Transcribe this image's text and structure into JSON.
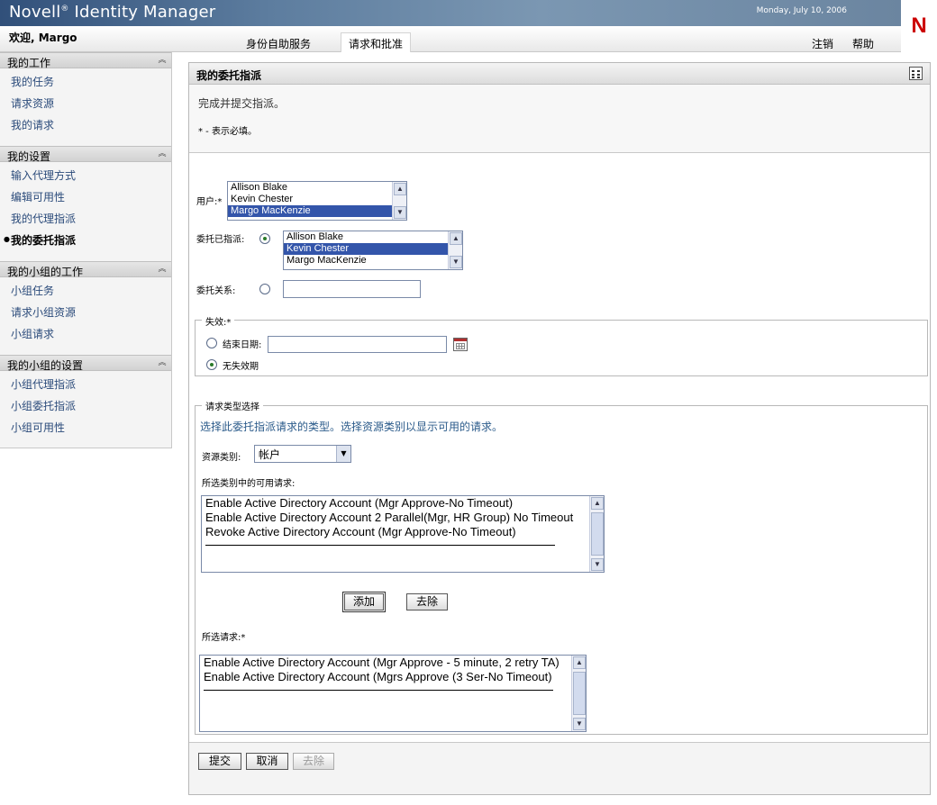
{
  "header": {
    "app_title": "Novell",
    "app_title_mark": "®",
    "app_title_rest": "Identity Manager",
    "date": "Monday, July 10, 2006",
    "logo": "N",
    "welcome": "欢迎, Margo",
    "tabs": [
      {
        "label": "身份自助服务"
      },
      {
        "label": "请求和批准"
      }
    ],
    "logout": "注销",
    "help": "帮助"
  },
  "sidebar": {
    "sections": [
      {
        "title": "我的工作",
        "items": [
          "我的任务",
          "请求资源",
          "我的请求"
        ]
      },
      {
        "title": "我的设置",
        "items": [
          "输入代理方式",
          "编辑可用性",
          "我的代理指派",
          "我的委托指派"
        ]
      },
      {
        "title": "我的小组的工作",
        "items": [
          "小组任务",
          "请求小组资源",
          "小组请求"
        ]
      },
      {
        "title": "我的小组的设置",
        "items": [
          "小组代理指派",
          "小组委托指派",
          "小组可用性"
        ]
      }
    ],
    "active_item": "我的委托指派"
  },
  "main": {
    "title": "我的委托指派",
    "intro": "完成并提交指派。",
    "required_note": "* - 表示必填。",
    "user_label": "用户:*",
    "users": [
      "Allison Blake",
      "Kevin Chester",
      "Margo MacKenzie"
    ],
    "users_selected": "Margo MacKenzie",
    "delegate_assigned_label": "委托已指派:",
    "delegates": [
      "Allison Blake",
      "Kevin Chester",
      "Margo MacKenzie"
    ],
    "delegates_selected": "Kevin Chester",
    "delegate_relation_label": "委托关系:",
    "delegate_relation_value": "",
    "expiry": {
      "legend": "失效:*",
      "end_date_label": "结束日期:",
      "end_date_value": "",
      "no_expiry_label": "无失效期"
    },
    "request_type": {
      "legend": "请求类型选择",
      "hint": "选择此委托指派请求的类型。选择资源类别以显示可用的请求。",
      "category_label": "资源类别:",
      "category_value": "帐户",
      "available_label": "所选类别中的可用请求:",
      "available": [
        "Enable Active Directory Account (Mgr Approve-No Timeout)",
        "Enable Active Directory Account 2 Parallel(Mgr, HR Group) No Timeout",
        "Revoke Active Directory Account (Mgr Approve-No Timeout)"
      ],
      "add_button": "添加",
      "remove_button": "去除",
      "selected_label": "所选请求:*",
      "selected": [
        "Enable Active Directory Account (Mgr Approve - 5 minute, 2 retry TA)",
        "Enable Active Directory Account (Mgrs Approve (3 Ser-No Timeout)"
      ]
    },
    "footer": {
      "submit": "提交",
      "cancel": "取消",
      "remove": "去除"
    }
  },
  "icons": {
    "collapse": "double-chevron-up-icon",
    "calendar": "calendar-icon",
    "layout": "layout-grid-icon"
  },
  "colors": {
    "banner": "#5d7d9f",
    "link": "#2a4a7a",
    "selection": "#3355aa",
    "logo": "#cc0000"
  }
}
